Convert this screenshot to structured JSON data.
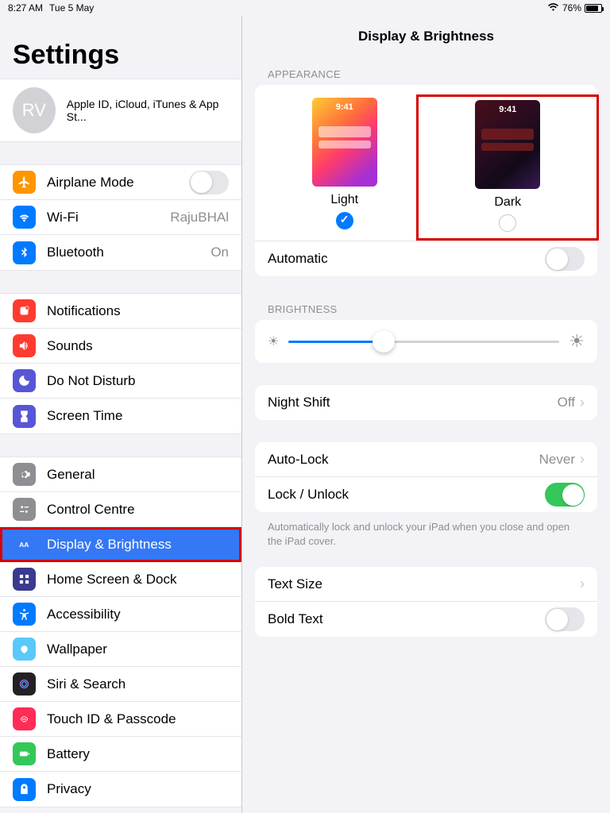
{
  "status": {
    "time": "8:27 AM",
    "date": "Tue 5 May",
    "battery": "76%"
  },
  "sidebar": {
    "title": "Settings",
    "account": {
      "initials": "RV",
      "subtitle": "Apple ID, iCloud, iTunes & App St..."
    },
    "g1": {
      "airplane": "Airplane Mode",
      "wifi": "Wi-Fi",
      "wifi_val": "RajuBHAl",
      "bt": "Bluetooth",
      "bt_val": "On"
    },
    "g2": {
      "notif": "Notifications",
      "sounds": "Sounds",
      "dnd": "Do Not Disturb",
      "st": "Screen Time"
    },
    "g3": {
      "general": "General",
      "cc": "Control Centre",
      "disp": "Display & Brightness",
      "home": "Home Screen & Dock",
      "acc": "Accessibility",
      "wall": "Wallpaper",
      "siri": "Siri & Search",
      "touch": "Touch ID & Passcode",
      "batt": "Battery",
      "priv": "Privacy"
    }
  },
  "main": {
    "title": "Display & Brightness",
    "appearance_header": "APPEARANCE",
    "light": "Light",
    "dark": "Dark",
    "thumb_time": "9:41",
    "automatic": "Automatic",
    "brightness_header": "BRIGHTNESS",
    "nightshift": "Night Shift",
    "nightshift_val": "Off",
    "autolock": "Auto-Lock",
    "autolock_val": "Never",
    "lockunlock": "Lock / Unlock",
    "lockunlock_note": "Automatically lock and unlock your iPad when you close and open the iPad cover.",
    "textsize": "Text Size",
    "bold": "Bold Text"
  }
}
